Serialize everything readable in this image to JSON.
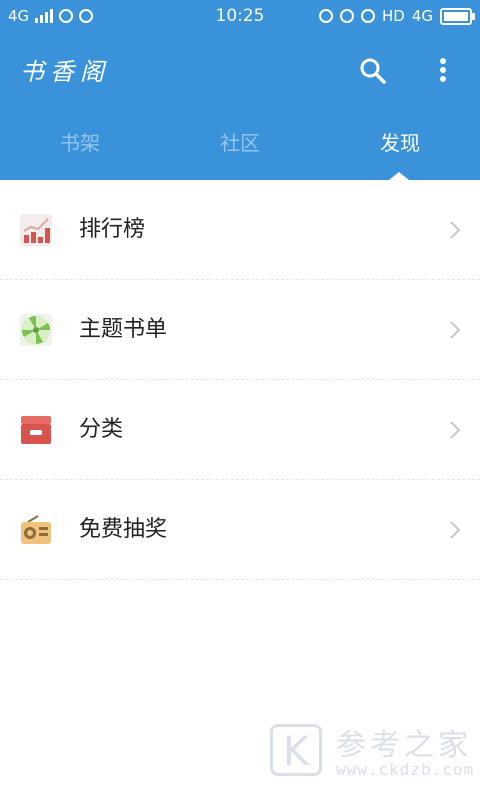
{
  "status_bar": {
    "network_left": "4G",
    "time": "10:25",
    "hd": "HD",
    "network_right": "4G"
  },
  "app_bar": {
    "logo": "书香阁",
    "tabs": [
      {
        "label": "书架",
        "active": false
      },
      {
        "label": "社区",
        "active": false
      },
      {
        "label": "发现",
        "active": true
      }
    ]
  },
  "list": [
    {
      "label": "排行榜",
      "icon": "ranking-chart-icon"
    },
    {
      "label": "主题书单",
      "icon": "candy-swirl-icon"
    },
    {
      "label": "分类",
      "icon": "category-box-icon"
    },
    {
      "label": "免费抽奖",
      "icon": "radio-icon"
    }
  ],
  "watermark": {
    "badge": "K",
    "text": "参考之家",
    "url": "www.ckdzb.com"
  },
  "colors": {
    "app_bar": "#3a93da",
    "tab_inactive": "#95c4ec",
    "tab_active": "#ffffff"
  }
}
